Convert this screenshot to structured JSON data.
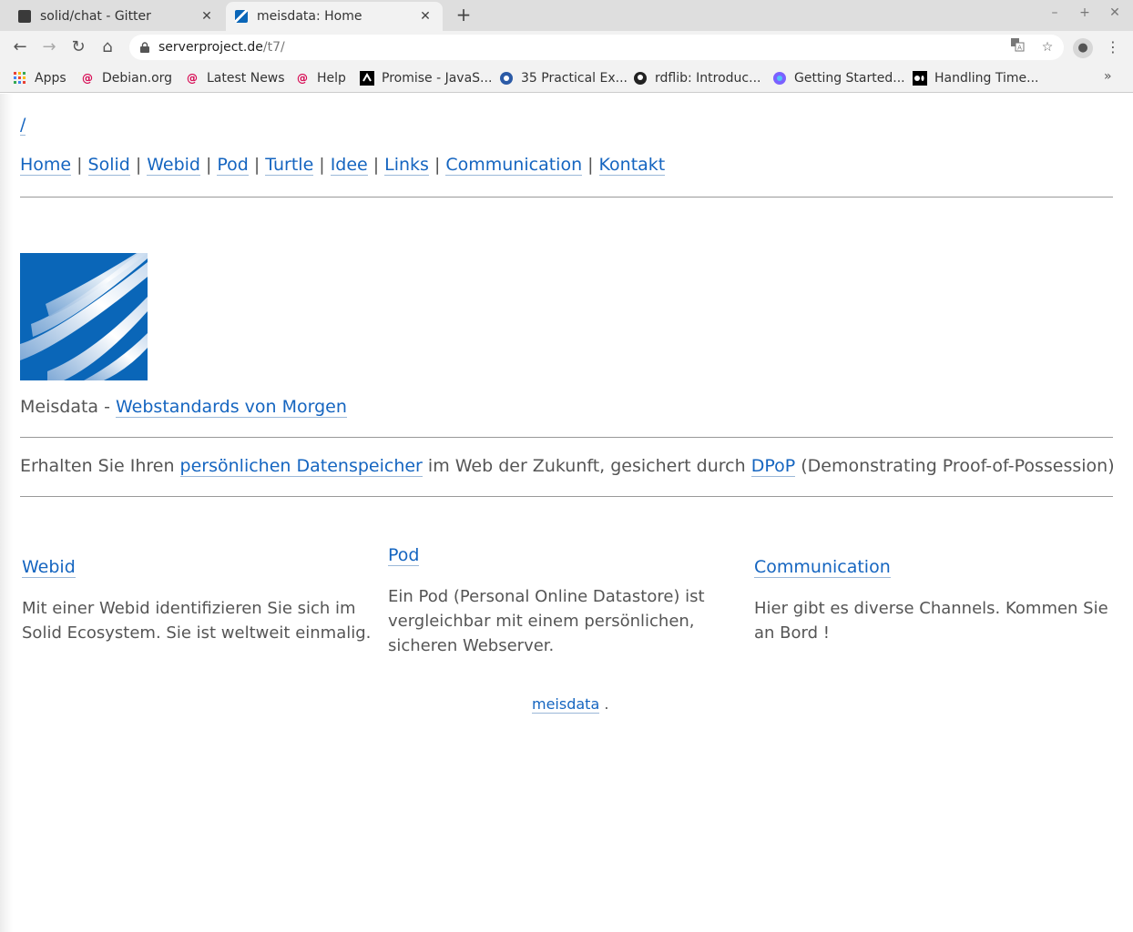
{
  "browser": {
    "tabs": [
      {
        "title": "solid/chat - Gitter",
        "active": false,
        "icon": "gitter-icon"
      },
      {
        "title": "meisdata: Home",
        "active": true,
        "icon": "meisdata-icon"
      }
    ],
    "url_host": "serverproject.de",
    "url_path": "/t7/",
    "bookmarks": [
      {
        "label": "Apps",
        "icon": "apps-grid-icon"
      },
      {
        "label": "Debian.org",
        "icon": "debian-icon"
      },
      {
        "label": "Latest News",
        "icon": "debian-icon"
      },
      {
        "label": "Help",
        "icon": "debian-icon"
      },
      {
        "label": "Promise - JavaS...",
        "icon": "mdn-icon"
      },
      {
        "label": "35 Practical Ex...",
        "icon": "site-icon"
      },
      {
        "label": "rdflib: Introduc...",
        "icon": "github-icon"
      },
      {
        "label": "Getting Started...",
        "icon": "site-icon"
      },
      {
        "label": "Handling Time...",
        "icon": "medium-icon"
      }
    ]
  },
  "page": {
    "breadcrumb": "/",
    "nav": [
      "Home",
      "Solid",
      "Webid",
      "Pod",
      "Turtle",
      "Idee",
      "Links",
      "Communication",
      "Kontakt"
    ],
    "nav_separator": "|",
    "tagline_prefix": "Meisdata - ",
    "tagline_link": "Webstandards von Morgen",
    "intro_before": "Erhalten Sie Ihren ",
    "intro_link1": "persönlichen Datenspeicher",
    "intro_middle": " im Web der Zukunft, gesichert durch ",
    "intro_link2": "DPoP",
    "intro_after": " (Demonstrating Proof-of-Possession)",
    "columns": [
      {
        "heading": "Webid",
        "text": "Mit einer Webid identifizieren Sie sich im Solid Ecosystem. Sie ist weltweit einmalig."
      },
      {
        "heading": "Pod",
        "text": "Ein Pod (Personal Online Datastore) ist vergleichbar mit einem persönlichen, sicheren Webserver."
      },
      {
        "heading": "Communication",
        "text": "Hier gibt es diverse Channels. Kommen Sie an Bord !"
      }
    ],
    "footer_link": "meisdata",
    "footer_suffix": " ."
  },
  "colors": {
    "link": "#1565c0",
    "text": "#555555",
    "logo_blue": "#0a66b8"
  }
}
